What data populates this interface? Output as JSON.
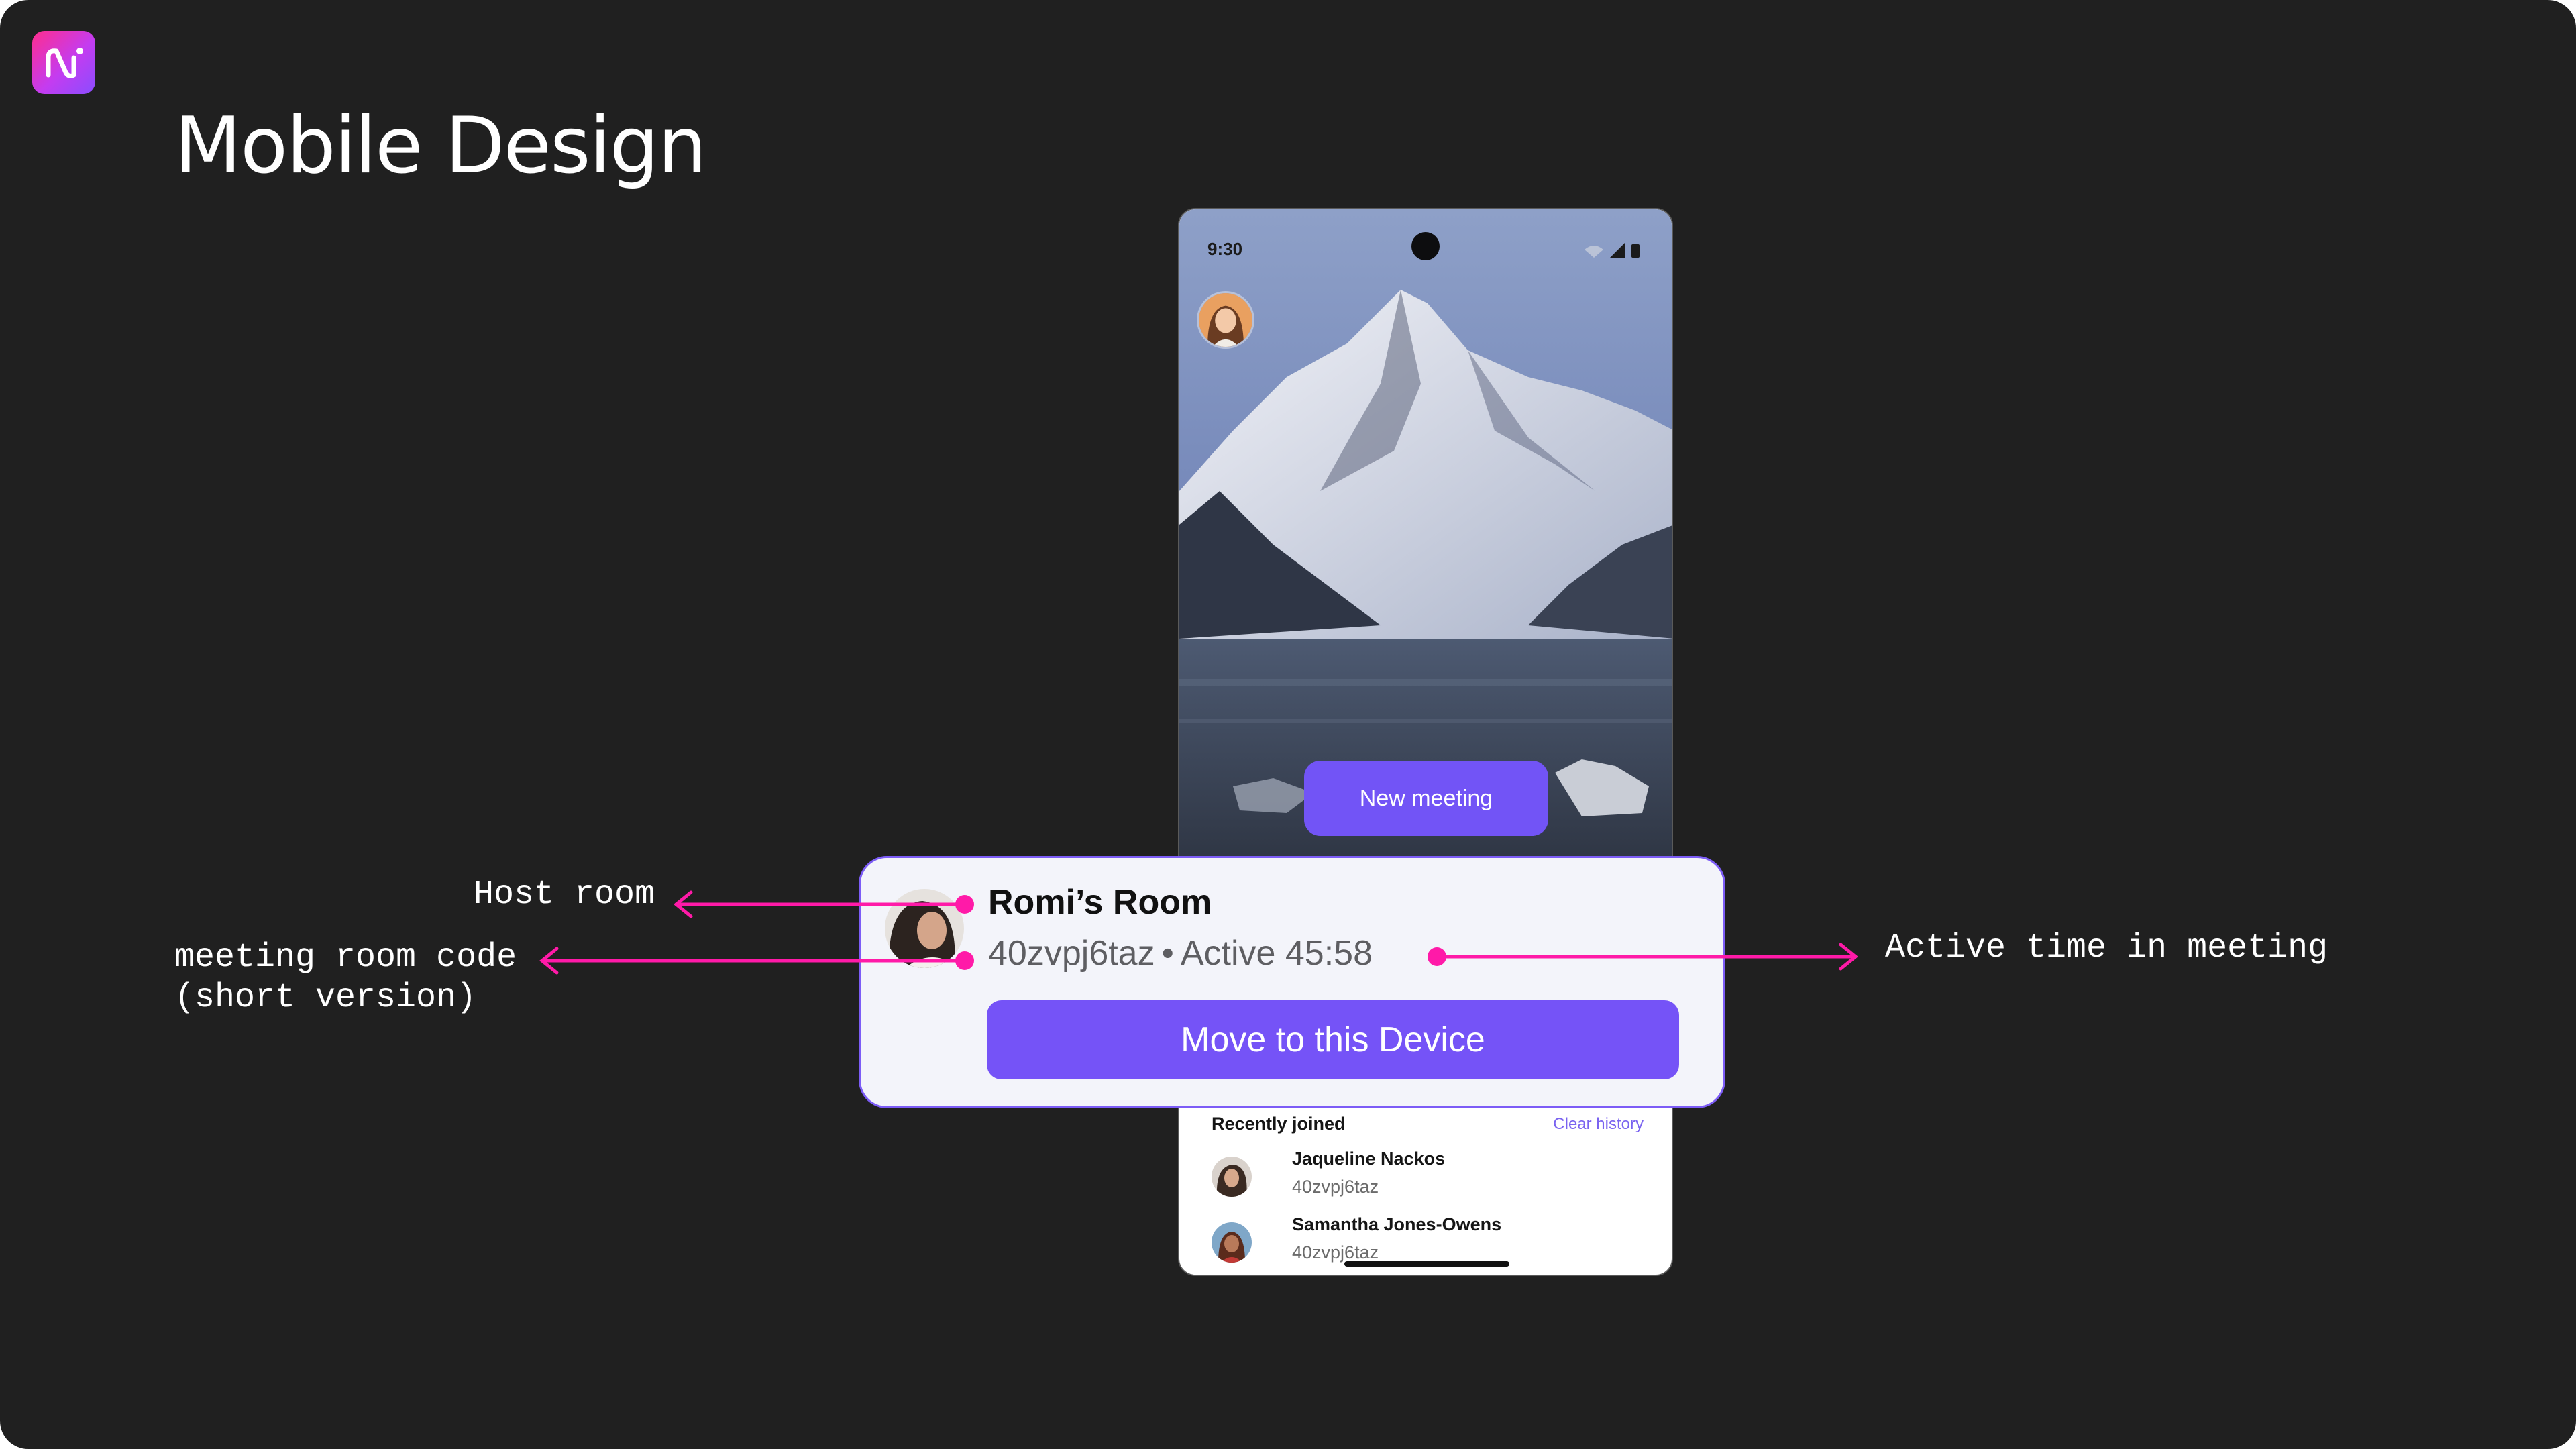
{
  "slide": {
    "title": "Mobile Design"
  },
  "phone": {
    "status_time": "9:30",
    "new_meeting_label": "New meeting",
    "recently_joined_label": "Recently joined",
    "clear_history_label": "Clear history",
    "recent": [
      {
        "name": "Jaqueline Nackos",
        "code": "40zvpj6taz"
      },
      {
        "name": "Samantha Jones-Owens",
        "code": "40zvpj6taz"
      }
    ]
  },
  "card": {
    "room_name": "Romi’s Room",
    "room_code": "40zvpj6taz",
    "separator": "•",
    "active_time": "Active 45:58",
    "move_button_label": "Move to this Device"
  },
  "annotations": {
    "host_room": "Host room",
    "room_code_line1": "meeting room code",
    "room_code_line2": "(short version)",
    "active_time": "Active time in meeting"
  },
  "colors": {
    "background": "#202020",
    "accent": "#7553f7",
    "annotation": "#ff1aa8"
  }
}
